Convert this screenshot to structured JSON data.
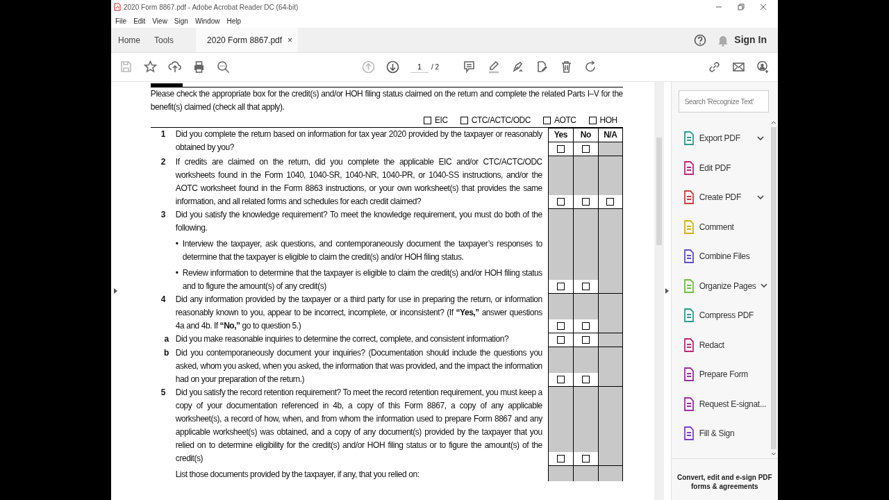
{
  "window": {
    "title": "2020 Form 8867.pdf - Adobe Acrobat Reader DC (64-bit)"
  },
  "menu": [
    "File",
    "Edit",
    "View",
    "Sign",
    "Window",
    "Help"
  ],
  "tabs": [
    {
      "label": "Home",
      "selected": false,
      "kind": "nav"
    },
    {
      "label": "Tools",
      "selected": false,
      "kind": "nav"
    },
    {
      "label": "2020 Form 8867.pdf",
      "selected": true,
      "kind": "document",
      "close": "×"
    }
  ],
  "sign_in": "Sign In",
  "toolbar": {
    "page_current": "1",
    "page_total": "/ 2"
  },
  "form": {
    "intro": "Please check the appropriate box for the credit(s) and/or HOH filing status claimed on the return and complete the related Parts I–V for the benefit(s) claimed (check all that apply).",
    "credits": [
      {
        "label": "EIC",
        "checked": false
      },
      {
        "label": "CTC/ACTC/ODC",
        "checked": false
      },
      {
        "label": "AOTC",
        "checked": false
      },
      {
        "label": "HOH",
        "checked": false
      }
    ],
    "columns": [
      "Yes",
      "No",
      "N/A"
    ],
    "rows": [
      {
        "kind": "question",
        "number": "1",
        "paragraphs": [
          "Did you complete the return based on information for tax year 2020 provided by the taxpayer or reasonably obtained by you?"
        ],
        "boxes": [
          {
            "checked": false
          },
          {
            "checked": false
          }
        ]
      },
      {
        "kind": "question",
        "number": "2",
        "paragraphs": [
          "If credits are claimed on the return, did you complete the applicable EIC and/or CTC/ACTC/ODC worksheets found in the Form 1040, 1040-SR, 1040-NR, 1040-PR, or 1040-SS instructions, and/or the AOTC worksheet found in the Form 8863 instructions, or your own worksheet(s) that provides the same information, and all related forms and schedules for each credit claimed?"
        ],
        "boxes": [
          {
            "checked": false
          },
          {
            "checked": false
          },
          {
            "checked": false
          }
        ]
      },
      {
        "kind": "question",
        "number": "3",
        "paragraphs": [
          "Did you satisfy the knowledge requirement? To meet the knowledge requirement, you must do both of the following."
        ],
        "bullets": [
          {
            "marker": "•",
            "text": "Interview the taxpayer, ask questions, and contemporaneously document the taxpayer’s responses to determine that the taxpayer is eligible to claim the credit(s) and/or HOH filing status."
          },
          {
            "marker": "•",
            "text": "Review information to determine that the taxpayer is eligible to claim the credit(s) and/or HOH filing status and to figure the amount(s) of any credit(s)"
          }
        ],
        "boxes": [
          {
            "checked": false
          },
          {
            "checked": false
          }
        ]
      },
      {
        "kind": "question",
        "number": "4",
        "paragraphs": [
          "Did any information provided by the taxpayer or a third party for use in preparing the return, or information reasonably known to you, appear to be incorrect, incomplete, or inconsistent? (If **“Yes,”** answer questions 4a and 4b. If **“No,”** go  to question 5.)"
        ],
        "boxes": [
          {
            "checked": false
          },
          {
            "checked": false
          }
        ]
      },
      {
        "kind": "sub",
        "number": "a",
        "paragraphs": [
          "Did you make reasonable inquiries to determine the correct, complete, and consistent information?"
        ],
        "boxes": [
          {
            "checked": false
          },
          {
            "checked": false
          }
        ]
      },
      {
        "kind": "sub",
        "number": "b",
        "paragraphs": [
          "Did you contemporaneously document your inquiries? (Documentation should include the questions you asked, whom you asked, when you asked, the information that was provided, and the impact the information had on your preparation of the return.)"
        ],
        "boxes": [
          {
            "checked": false
          },
          {
            "checked": false
          }
        ]
      },
      {
        "kind": "question",
        "number": "5",
        "paragraphs": [
          "Did you satisfy the record retention requirement? To meet the record retention requirement, you must keep a copy of your documentation referenced in 4b, a copy of this Form 8867, a copy of any applicable worksheet(s), a record of how, when, and from whom the information used to prepare Form 8867 and any applicable worksheet(s) was obtained, and a copy of any document(s) provided by the taxpayer that you relied on to determine eligibility for the credit(s) and/or HOH filing status or to figure the amount(s) of the credit(s)"
        ],
        "boxes": [
          {
            "checked": false
          },
          {
            "checked": false
          }
        ]
      },
      {
        "kind": "note",
        "paragraphs": [
          "List those documents provided by the taxpayer, if any, that you relied on:"
        ]
      }
    ]
  },
  "tools_panel": {
    "search_placeholder": "Search 'Recognize Text'",
    "items": [
      {
        "label": "Export PDF",
        "expandable": true,
        "color": "#2a9d8f"
      },
      {
        "label": "Edit PDF",
        "expandable": false,
        "color": "#c2247a"
      },
      {
        "label": "Create PDF",
        "expandable": true,
        "color": "#d13a3a"
      },
      {
        "label": "Comment",
        "expandable": false,
        "color": "#d4b30f"
      },
      {
        "label": "Combine Files",
        "expandable": false,
        "color": "#5b4fcf"
      },
      {
        "label": "Organize Pages",
        "expandable": true,
        "color": "#6cbf3a"
      },
      {
        "label": "Compress PDF",
        "expandable": false,
        "color": "#2a9d8f"
      },
      {
        "label": "Redact",
        "expandable": false,
        "color": "#c2247a"
      },
      {
        "label": "Prepare Form",
        "expandable": false,
        "color": "#a02ba6"
      },
      {
        "label": "Request E-signat...",
        "expandable": false,
        "color": "#a02ba6"
      },
      {
        "label": "Fill & Sign",
        "expandable": false,
        "color": "#7b3fd1"
      }
    ],
    "footer": "Convert, edit and e-sign PDF forms & agreements"
  }
}
